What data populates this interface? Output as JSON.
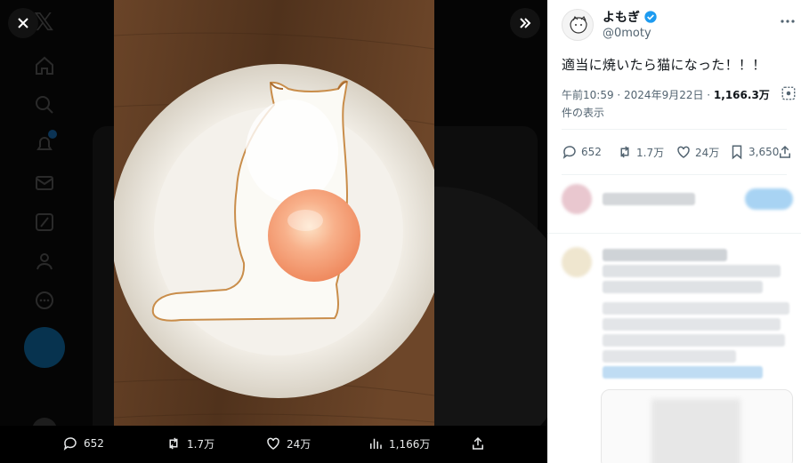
{
  "viewer": {
    "close_label": "close",
    "expand_label": "expand"
  },
  "photo": {
    "subject": "fried egg shaped like a sitting cat on a white plate"
  },
  "bottom_bar": {
    "replies": "652",
    "reposts": "1.7万",
    "likes": "24万",
    "views": "1,166万"
  },
  "post": {
    "author_name": "よもぎ",
    "author_handle": "@0moty",
    "text": "適当に焼いたら猫になった！！！",
    "time_date": "午前10:59 · 2024年9月22日 · ",
    "view_count": "1,166.3万",
    "view_suffix": "件の表示",
    "replies": "652",
    "reposts": "1.7万",
    "likes": "24万",
    "bookmarks": "3,650"
  },
  "colors": {
    "accent": "#1d9bf0",
    "panel_bg": "#ffffff",
    "secondary_text": "#536471"
  }
}
